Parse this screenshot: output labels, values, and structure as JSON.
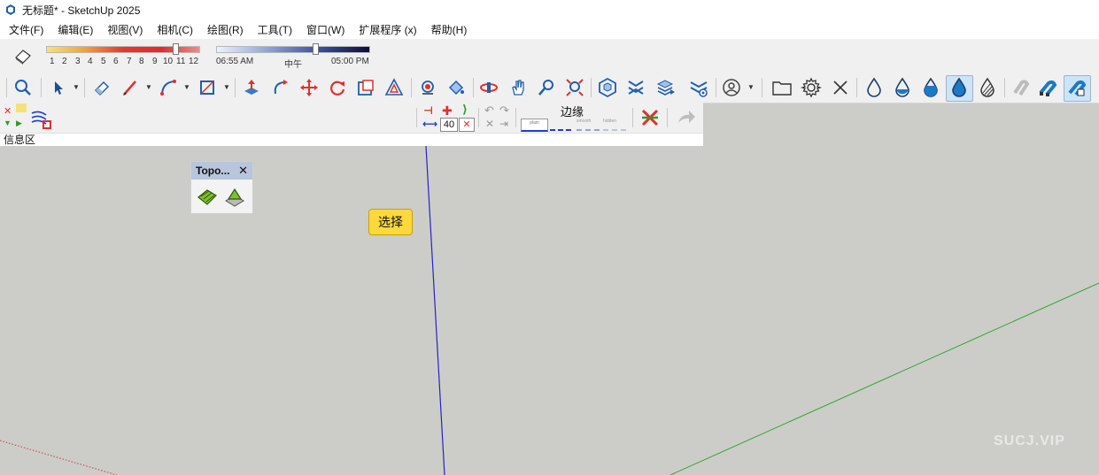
{
  "window": {
    "title": "无标题* - SketchUp 2025"
  },
  "menu": [
    "文件(F)",
    "编辑(E)",
    "视图(V)",
    "相机(C)",
    "绘图(R)",
    "工具(T)",
    "窗口(W)",
    "扩展程序 (x)",
    "帮助(H)"
  ],
  "shadows": {
    "month_ticks": [
      "1",
      "2",
      "3",
      "4",
      "5",
      "6",
      "7",
      "8",
      "9",
      "10",
      "11",
      "12"
    ],
    "month_value": 11,
    "time_labels": [
      "06:55 AM",
      "中午",
      "05:00 PM"
    ],
    "time_value": 0.72
  },
  "toolbar3": {
    "select_label": "选择",
    "stitch_value": "40",
    "edge_label": "边缘",
    "edge_styles": [
      "plain",
      "",
      "smooth",
      "hidden"
    ]
  },
  "infobar": {
    "label": "信息区"
  },
  "topo_panel": {
    "title": "Topo...",
    "close": "✕"
  },
  "watermark": "SUCJ.VIP",
  "axes": {
    "blue": "#1a1acc",
    "green": "#22aa22",
    "red": "#cc2222"
  },
  "accent": {
    "select_yellow": "#ffd83b",
    "active_blue": "#cce4f7"
  }
}
